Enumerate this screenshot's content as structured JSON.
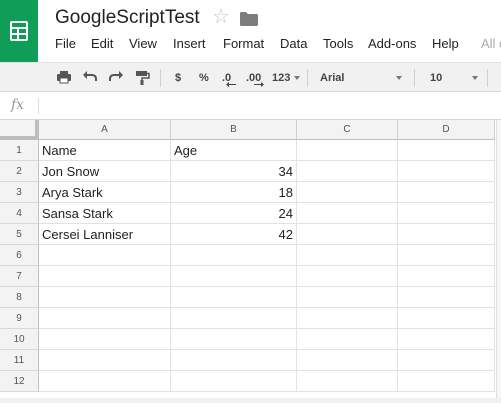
{
  "document": {
    "title": "GoogleScriptTest"
  },
  "menu": [
    "File",
    "Edit",
    "View",
    "Insert",
    "Format",
    "Data",
    "Tools",
    "Add-ons",
    "Help",
    "All c"
  ],
  "toolbar": {
    "currency": "$",
    "percent": "%",
    "decrease_decimal": ".0",
    "increase_decimal": ".00",
    "more_formats": "123",
    "font": "Arial",
    "font_size": "10"
  },
  "formula_bar": {
    "label": "fx",
    "value": ""
  },
  "grid": {
    "columns": [
      "A",
      "B",
      "C",
      "D"
    ],
    "rows": [
      "1",
      "2",
      "3",
      "4",
      "5",
      "6",
      "7",
      "8",
      "9",
      "10",
      "11",
      "12"
    ],
    "cells": [
      [
        "Name",
        "Age",
        "",
        ""
      ],
      [
        "Jon Snow",
        "34",
        "",
        ""
      ],
      [
        "Arya Stark",
        "18",
        "",
        ""
      ],
      [
        "Sansa Stark",
        "24",
        "",
        ""
      ],
      [
        "Cersei Lanniser",
        "42",
        "",
        ""
      ],
      [
        "",
        "",
        "",
        ""
      ],
      [
        "",
        "",
        "",
        ""
      ],
      [
        "",
        "",
        "",
        ""
      ],
      [
        "",
        "",
        "",
        ""
      ],
      [
        "",
        "",
        "",
        ""
      ],
      [
        "",
        "",
        "",
        ""
      ],
      [
        "",
        "",
        "",
        ""
      ]
    ],
    "numeric_cells": [
      "B2",
      "B3",
      "B4",
      "B5"
    ]
  },
  "colors": {
    "brand": "#0f9d58",
    "toolbar_bg": "#f1f1f1",
    "header_bg": "#f3f3f3"
  }
}
